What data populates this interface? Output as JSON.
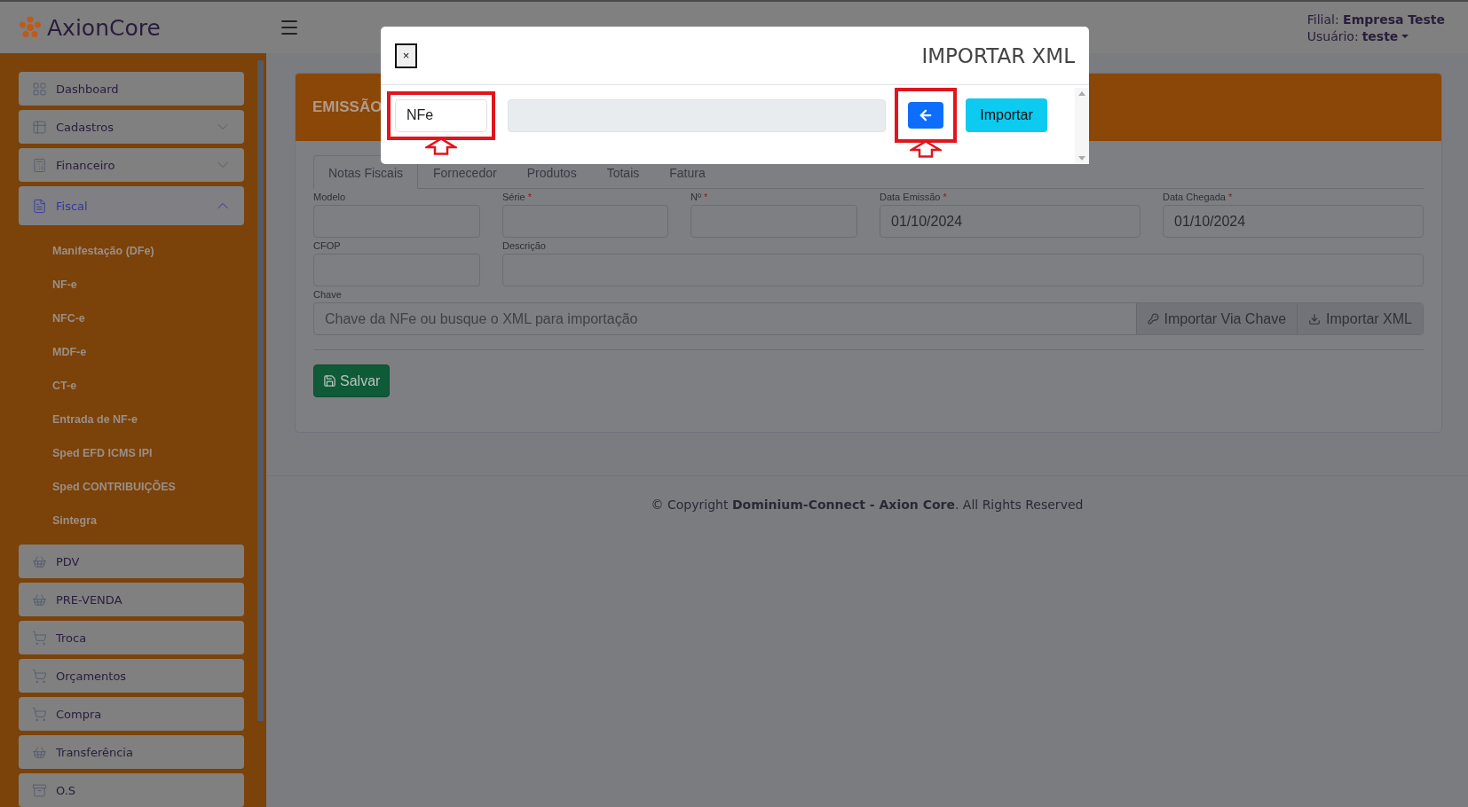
{
  "brand": {
    "name": "AxionCore"
  },
  "header": {
    "branch_label": "Filial:",
    "branch": "Empresa Teste",
    "user_label": "Usuário:",
    "user": "teste"
  },
  "sidebar": {
    "items": [
      {
        "kind": "link",
        "label": "Dashboard",
        "selected": false
      },
      {
        "kind": "group",
        "label": "Cadastros",
        "selected": false,
        "expanded": false
      },
      {
        "kind": "group",
        "label": "Financeiro",
        "selected": false,
        "expanded": false
      },
      {
        "kind": "group",
        "label": "Fiscal",
        "selected": true,
        "expanded": true,
        "children": [
          "Manifestação (DFe)",
          "NF-e",
          "NFC-e",
          "MDF-e",
          "CT-e",
          "Entrada de NF-e",
          "Sped EFD ICMS IPI",
          "Sped CONTRIBUIÇÕES",
          "Sintegra"
        ]
      },
      {
        "kind": "link",
        "label": "PDV",
        "selected": false
      },
      {
        "kind": "link",
        "label": "PRE-VENDA",
        "selected": false
      },
      {
        "kind": "link",
        "label": "Troca",
        "selected": false
      },
      {
        "kind": "link",
        "label": "Orçamentos",
        "selected": false
      },
      {
        "kind": "link",
        "label": "Compra",
        "selected": false
      },
      {
        "kind": "link",
        "label": "Transferência",
        "selected": false
      },
      {
        "kind": "link",
        "label": "O.S",
        "selected": false
      }
    ]
  },
  "card": {
    "title": "EMISSÃO",
    "tabs": [
      {
        "label": "Notas Fiscais",
        "selected": true
      },
      {
        "label": "Fornecedor",
        "selected": false
      },
      {
        "label": "Produtos",
        "selected": false
      },
      {
        "label": "Totais",
        "selected": false
      },
      {
        "label": "Fatura",
        "selected": false
      }
    ],
    "field_rows": [
      [
        {
          "label": "Modelo"
        },
        {
          "label": "Série",
          "required_mark": "*"
        },
        {
          "label": "Nº",
          "required_mark": "*"
        },
        {
          "label": "Data Emissão",
          "required_mark": "*",
          "value": "01/10/2024"
        },
        {
          "label": "Data Chegada",
          "required_mark": "*",
          "value": "01/10/2024"
        }
      ],
      [
        {
          "label": "CFOP"
        },
        {
          "label": "Descrição"
        }
      ]
    ],
    "key_field": {
      "label": "Chave",
      "placeholder": "Chave da NFe ou busque o XML para importação",
      "buttons": [
        "Importar Via Chave",
        "Importar XML"
      ]
    },
    "save_button": "Salvar"
  },
  "footer": {
    "text": "© Copyright **Dominium-Connect - Axion Core**. All Rights Reserved"
  },
  "modal": {
    "title": "IMPORTAR XML",
    "close": "×",
    "type_select": {
      "value": "NFe",
      "highlighted": true
    },
    "back_button": {
      "highlighted": true
    },
    "import_button": "Importar"
  }
}
